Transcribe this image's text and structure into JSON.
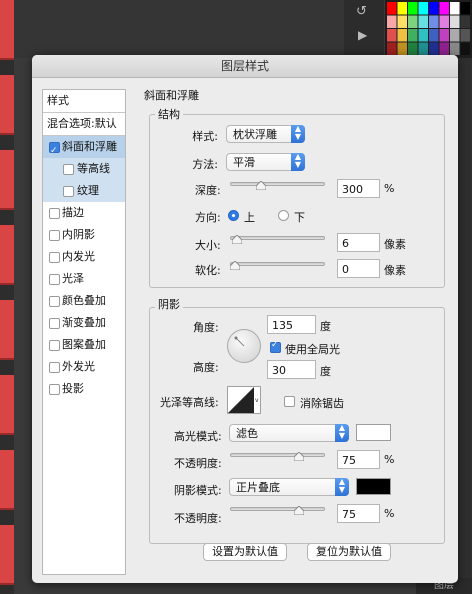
{
  "app": {
    "bottom_right_label": "图层"
  },
  "dialog": {
    "title": "图层样式",
    "left_panel": {
      "header": "样式",
      "blend_options": "混合选项:默认",
      "items": [
        {
          "label": "斜面和浮雕",
          "checked": true
        },
        {
          "label": "等高线",
          "checked": false
        },
        {
          "label": "纹理",
          "checked": false
        },
        {
          "label": "描边",
          "checked": false
        },
        {
          "label": "内阴影",
          "checked": false
        },
        {
          "label": "内发光",
          "checked": false
        },
        {
          "label": "光泽",
          "checked": false
        },
        {
          "label": "颜色叠加",
          "checked": false
        },
        {
          "label": "渐变叠加",
          "checked": false
        },
        {
          "label": "图案叠加",
          "checked": false
        },
        {
          "label": "外发光",
          "checked": false
        },
        {
          "label": "投影",
          "checked": false
        }
      ]
    },
    "bevel": {
      "title": "斜面和浮雕",
      "structure": {
        "title": "结构",
        "style_label": "样式:",
        "style_value": "枕状浮雕",
        "technique_label": "方法:",
        "technique_value": "平滑",
        "depth_label": "深度:",
        "depth_value": "300",
        "depth_unit": "%",
        "depth_slider": 0.3,
        "direction_label": "方向:",
        "direction_up": "上",
        "direction_down": "下",
        "direction_selected": "上",
        "size_label": "大小:",
        "size_value": "6",
        "size_unit": "像素",
        "size_slider": 0.02,
        "soften_label": "软化:",
        "soften_value": "0",
        "soften_unit": "像素",
        "soften_slider": 0.0
      },
      "shading": {
        "title": "阴影",
        "angle_label": "角度:",
        "angle_value": "135",
        "angle_unit": "度",
        "global_light_label": "使用全局光",
        "global_light_checked": true,
        "altitude_label": "高度:",
        "altitude_value": "30",
        "altitude_unit": "度",
        "gloss_contour_label": "光泽等高线:",
        "anti_alias_label": "消除锯齿",
        "anti_alias_checked": false,
        "highlight_mode_label": "高光模式:",
        "highlight_mode_value": "滤色",
        "highlight_color": "#ffffff",
        "highlight_opacity_label": "不透明度:",
        "highlight_opacity_value": "75",
        "highlight_opacity_unit": "%",
        "highlight_opacity_slider": 0.75,
        "shadow_mode_label": "阴影模式:",
        "shadow_mode_value": "正片叠底",
        "shadow_color": "#000000",
        "shadow_opacity_label": "不透明度:",
        "shadow_opacity_value": "75",
        "shadow_opacity_unit": "%",
        "shadow_opacity_slider": 0.75
      },
      "make_default": "设置为默认值",
      "reset_default": "复位为默认值"
    }
  }
}
